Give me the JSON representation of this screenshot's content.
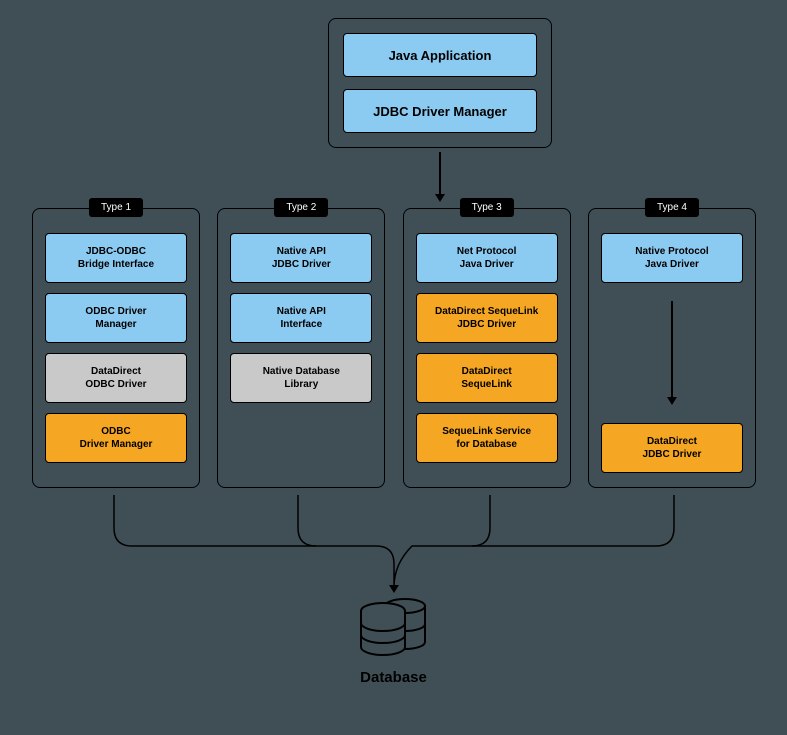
{
  "top": {
    "box1": "Java Application",
    "box2": "JDBC Driver Manager"
  },
  "columns": [
    {
      "label": "Type 1",
      "boxes": [
        {
          "text": "JDBC-ODBC\nBridge Interface",
          "color": "blue"
        },
        {
          "text": "ODBC Driver\nManager",
          "color": "blue"
        },
        {
          "text": "DataDirect\nODBC Driver",
          "color": "gray"
        },
        {
          "text": "ODBC\nDriver Manager",
          "color": "orange"
        }
      ]
    },
    {
      "label": "Type 2",
      "boxes": [
        {
          "text": "Native API\nJDBC Driver",
          "color": "blue"
        },
        {
          "text": "Native API\nInterface",
          "color": "blue"
        },
        {
          "text": "Native Database\nLibrary",
          "color": "gray"
        }
      ]
    },
    {
      "label": "Type 3",
      "boxes": [
        {
          "text": "Net Protocol\nJava Driver",
          "color": "blue"
        },
        {
          "text": "DataDirect SequeLink\nJDBC Driver",
          "color": "orange"
        },
        {
          "text": "DataDirect\nSequeLink",
          "color": "orange"
        },
        {
          "text": "SequeLink Service\nfor Database",
          "color": "orange"
        }
      ]
    },
    {
      "label": "Type 4",
      "boxes": [
        {
          "text": "Native Protocol\nJava Driver",
          "color": "blue"
        },
        {
          "text": "DataDirect\nJDBC Driver",
          "color": "orange"
        }
      ]
    }
  ],
  "database": {
    "label": "Database"
  }
}
